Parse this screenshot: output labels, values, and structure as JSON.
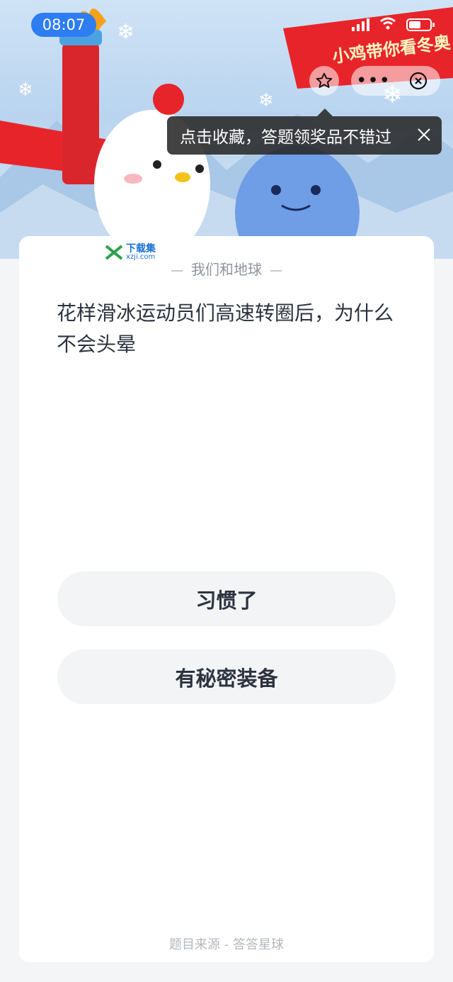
{
  "status_bar": {
    "time": "08:07"
  },
  "banner": {
    "ribbon_text": "小鸡带你看冬奥"
  },
  "tooltip": {
    "text": "点击收藏，答题领奖品不错过"
  },
  "watermark": {
    "name": "下载集",
    "url": "xzji.com"
  },
  "quiz": {
    "category": "我们和地球",
    "question": "花样滑冰运动员们高速转圈后，为什么不会头晕",
    "answers": [
      "习惯了",
      "有秘密装备"
    ],
    "source": "题目来源 - 答答星球"
  },
  "colors": {
    "accent": "#2e7df2",
    "ribbon": "#e8242b",
    "card": "#ffffff",
    "answer_bg": "#f3f4f6"
  },
  "icons": [
    "star-icon",
    "more-icon",
    "close-circle-icon",
    "close-icon",
    "signal-icon",
    "wifi-icon",
    "battery-icon"
  ]
}
